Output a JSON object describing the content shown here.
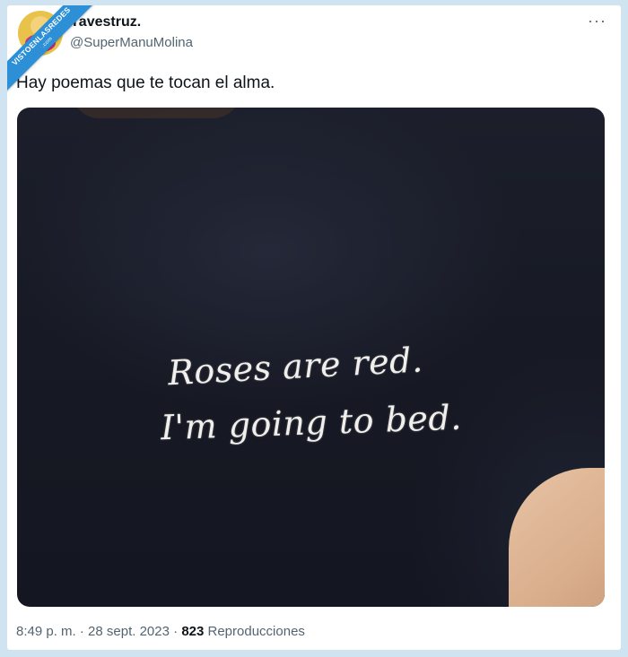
{
  "watermark": {
    "line1": "VISTOENLASREDES",
    "line2": ".com"
  },
  "tweet": {
    "display_name": "Yavestruz.",
    "handle": "@SuperManuMolina",
    "text": "Hay poemas que te tocan el alma.",
    "more_label": "···",
    "image": {
      "line1": "Roses are red.",
      "line2": "I'm going to bed."
    },
    "meta": {
      "time": "8:49 p. m.",
      "sep1": " · ",
      "date": "28 sept. 2023",
      "sep2": " · ",
      "views_count": "823",
      "views_label": " Reproducciones"
    }
  },
  "colors": {
    "background": "#cfe3f1",
    "card": "#ffffff",
    "text_primary": "#0f1419",
    "text_secondary": "#536471",
    "ribbon": "#2d8fd5"
  }
}
